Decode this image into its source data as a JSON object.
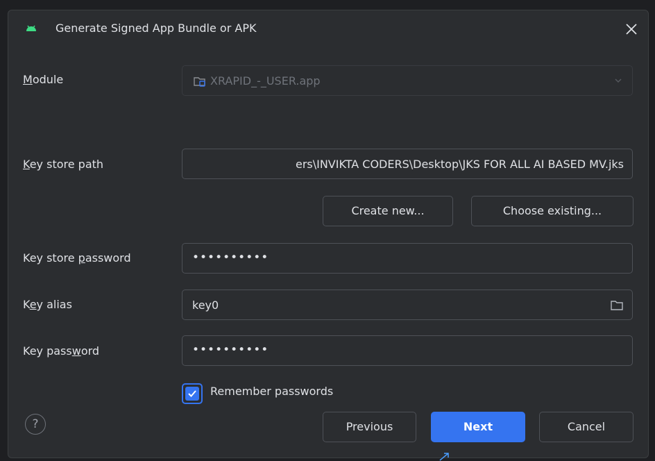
{
  "dialog": {
    "title": "Generate Signed App Bundle or APK"
  },
  "module": {
    "label_prefix": "",
    "label_mnemonic": "M",
    "label_rest": "odule",
    "value": "XRAPID_-_USER.app"
  },
  "key_store_path": {
    "label_mnemonic": "K",
    "label_rest": "ey store path",
    "value": "ers\\INVIKTA CODERS\\Desktop\\JKS FOR ALL AI BASED MV.jks"
  },
  "actions": {
    "create_new": "Create new...",
    "choose_existing": "Choose existing..."
  },
  "key_store_password": {
    "label_prefix": "Key store ",
    "label_mnemonic": "p",
    "label_rest": "assword",
    "value": "••••••••••"
  },
  "key_alias": {
    "label_prefix": "K",
    "label_mnemonic": "e",
    "label_rest": "y alias",
    "value": "key0"
  },
  "key_password": {
    "label_prefix": "Key pass",
    "label_mnemonic": "w",
    "label_rest": "ord",
    "value": "••••••••••"
  },
  "remember": {
    "label": "Remember passwords",
    "checked": true
  },
  "footer": {
    "help": "?",
    "previous": "Previous",
    "next": "Next",
    "cancel": "Cancel"
  },
  "colors": {
    "accent": "#3574f0",
    "background": "#2b2d30",
    "text": "#dfe1e5",
    "android": "#3ddc84"
  }
}
